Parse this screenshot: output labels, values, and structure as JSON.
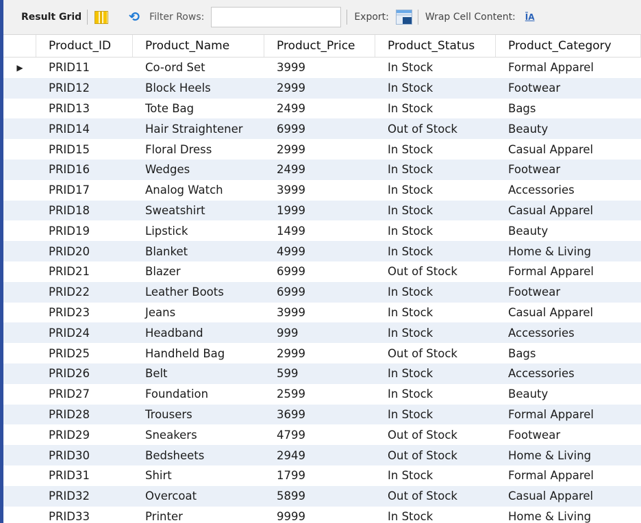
{
  "toolbar": {
    "result_grid_label": "Result Grid",
    "filter_label": "Filter Rows:",
    "filter_value": "",
    "export_label": "Export:",
    "wrap_label": "Wrap Cell Content:",
    "wrap_glyph": "ĪA"
  },
  "grid": {
    "columns": [
      "Product_ID",
      "Product_Name",
      "Product_Price",
      "Product_Status",
      "Product_Category"
    ],
    "rows": [
      [
        "PRID11",
        "Co-ord Set",
        "3999",
        "In Stock",
        "Formal Apparel"
      ],
      [
        "PRID12",
        "Block Heels",
        "2999",
        "In Stock",
        "Footwear"
      ],
      [
        "PRID13",
        "Tote Bag",
        "2499",
        "In Stock",
        "Bags"
      ],
      [
        "PRID14",
        "Hair Straightener",
        "6999",
        "Out of Stock",
        "Beauty"
      ],
      [
        "PRID15",
        "Floral Dress",
        "2999",
        "In Stock",
        "Casual Apparel"
      ],
      [
        "PRID16",
        "Wedges",
        "2499",
        "In Stock",
        "Footwear"
      ],
      [
        "PRID17",
        "Analog Watch",
        "3999",
        "In Stock",
        "Accessories"
      ],
      [
        "PRID18",
        "Sweatshirt",
        "1999",
        "In Stock",
        "Casual Apparel"
      ],
      [
        "PRID19",
        "Lipstick",
        "1499",
        "In Stock",
        "Beauty"
      ],
      [
        "PRID20",
        "Blanket",
        "4999",
        "In Stock",
        "Home & Living"
      ],
      [
        "PRID21",
        "Blazer",
        "6999",
        "Out of Stock",
        "Formal Apparel"
      ],
      [
        "PRID22",
        "Leather Boots",
        "6999",
        "In Stock",
        "Footwear"
      ],
      [
        "PRID23",
        "Jeans",
        "3999",
        "In Stock",
        "Casual Apparel"
      ],
      [
        "PRID24",
        "Headband",
        "999",
        "In Stock",
        "Accessories"
      ],
      [
        "PRID25",
        "Handheld Bag",
        "2999",
        "Out of Stock",
        "Bags"
      ],
      [
        "PRID26",
        "Belt",
        "599",
        "In Stock",
        "Accessories"
      ],
      [
        "PRID27",
        "Foundation",
        "2599",
        "In Stock",
        "Beauty"
      ],
      [
        "PRID28",
        "Trousers",
        "3699",
        "In Stock",
        "Formal Apparel"
      ],
      [
        "PRID29",
        "Sneakers",
        "4799",
        "Out of Stock",
        "Footwear"
      ],
      [
        "PRID30",
        "Bedsheets",
        "2949",
        "Out of Stock",
        "Home & Living"
      ],
      [
        "PRID31",
        "Shirt",
        "1799",
        "In Stock",
        "Formal Apparel"
      ],
      [
        "PRID32",
        "Overcoat",
        "5899",
        "Out of Stock",
        "Casual Apparel"
      ],
      [
        "PRID33",
        "Printer",
        "9999",
        "In Stock",
        "Home & Living"
      ]
    ],
    "current_row_marker": "▶"
  },
  "colors": {
    "alt_row": "#eaf0f8",
    "window_border": "#2e4fa0",
    "refresh_icon": "#1f7bd6"
  },
  "icons": [
    "grid-layout-icon",
    "refresh-icon",
    "export-icon",
    "wrap-text-icon",
    "current-row-pointer-icon"
  ]
}
